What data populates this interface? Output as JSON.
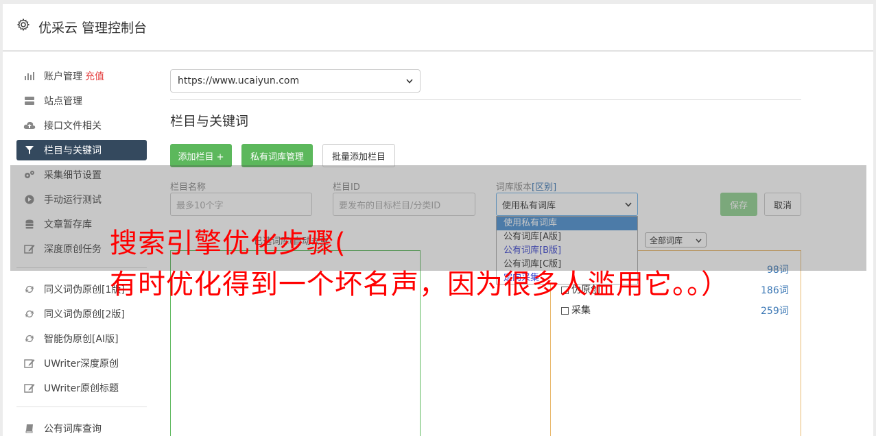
{
  "header": {
    "title": "优采云 管理控制台"
  },
  "sidebar": {
    "items": [
      {
        "label": "账户管理",
        "tag": "充值",
        "icon": "bar-chart-icon"
      },
      {
        "label": "站点管理",
        "icon": "server-icon"
      },
      {
        "label": "接口文件相关",
        "icon": "cloud-upload-icon"
      },
      {
        "label": "栏目与关键词",
        "icon": "filter-icon",
        "active": true
      },
      {
        "label": "采集细节设置",
        "icon": "cogs-icon"
      },
      {
        "label": "手动运行测试",
        "icon": "play-circle-icon"
      },
      {
        "label": "文章暂存库",
        "icon": "database-icon"
      },
      {
        "label": "深度原创任务",
        "icon": "edit-icon"
      }
    ],
    "items2": [
      {
        "label": "同义词伪原创[1版]",
        "icon": "refresh-icon"
      },
      {
        "label": "同义词伪原创[2版]",
        "icon": "refresh-icon"
      },
      {
        "label": "智能伪原创[AI版]",
        "icon": "refresh-icon"
      },
      {
        "label": "UWriter深度原创",
        "icon": "edit-icon"
      },
      {
        "label": "UWriter原创标题",
        "icon": "edit-icon"
      }
    ],
    "items3": [
      {
        "label": "公有词库查询",
        "icon": "book-icon"
      }
    ]
  },
  "main": {
    "site_select": "https://www.ucaiyun.com",
    "section_title": "栏目与关键词",
    "buttons": {
      "add_column": "添加栏目 +",
      "private_lib": "私有词库管理",
      "batch_add": "批量添加栏目",
      "save": "保存",
      "cancel": "取消"
    },
    "form": {
      "name_label": "栏目名称",
      "name_placeholder": "最多10个字",
      "id_label": "栏目ID",
      "id_placeholder": "要发布的目标栏目/分类ID",
      "lib_label": "词库版本",
      "lib_label_link": "[区别]",
      "lib_value": "使用私有词库"
    },
    "dropdown_options": [
      "使用私有词库",
      "公有词库[A版]",
      "公有词库[B版]",
      "公有词库[C版]",
      "定向采集"
    ],
    "box_caption": "已选词库(自动去重",
    "lib_filter": "全部词库",
    "libraries": [
      {
        "name": "",
        "count": "98词"
      },
      {
        "name": "伪原创",
        "count": "186词"
      },
      {
        "name": "采集",
        "count": "259词"
      }
    ]
  },
  "banner": {
    "line1": "搜索引擎优化步骤(",
    "line2": "有时优化得到一个坏名声，因为很多人滥用它。。）"
  },
  "colors": {
    "active_nav": "#34495e",
    "green_button": "#5cb85c",
    "banner_text": "#ff0000",
    "link_blue": "#3c78b5"
  }
}
